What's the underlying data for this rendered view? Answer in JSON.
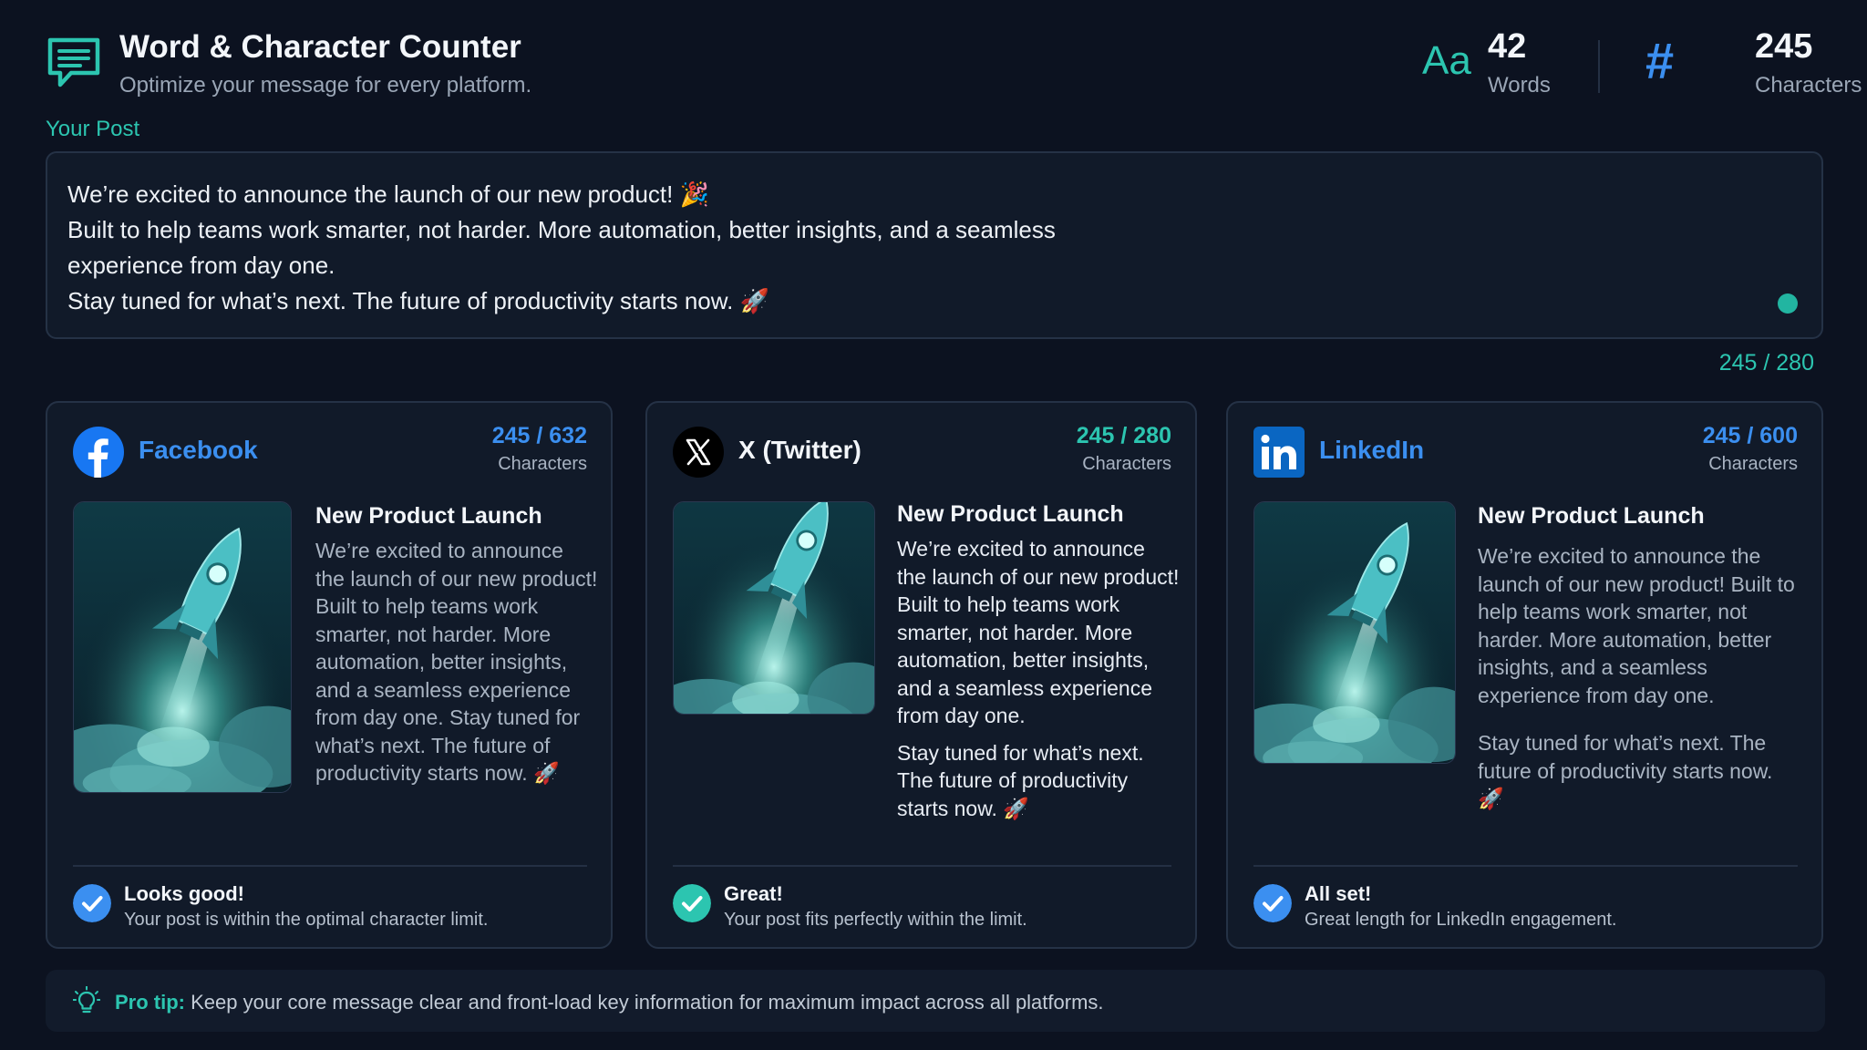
{
  "header": {
    "title": "Word & Character Counter",
    "subtitle": "Optimize your message for every platform.",
    "words": {
      "icon_text": "Aa",
      "value": "42",
      "label": "Words"
    },
    "characters": {
      "icon_text": "#",
      "value": "245",
      "label": "Characters"
    }
  },
  "post": {
    "label": "Your Post",
    "lines": [
      "We’re excited to announce the launch of our new product! 🎉",
      "Built to help teams work smarter, not harder. More automation, better insights, and a seamless",
      "experience from day one.",
      "Stay tuned for what’s next. The future of productivity starts now. 🚀"
    ],
    "count": "245 / 280"
  },
  "cards": [
    {
      "name": "Facebook",
      "count": "245 / 632",
      "count_label": "Characters",
      "headline": "New Product Launch",
      "paragraphs": [
        "We’re excited to announce the launch of our new product! Built to help teams work smarter, not harder. More automation, better insights, and a seamless experience from day one. Stay tuned for what’s next. The future of productivity starts now. 🚀"
      ],
      "status_title": "Looks good!",
      "status_desc": "Your post is within the optimal character limit.",
      "accent": "#3b8ff0"
    },
    {
      "name": "X (Twitter)",
      "count": "245 / 280",
      "count_label": "Characters",
      "headline": "New Product Launch",
      "paragraphs": [
        "We’re excited to announce the launch of our new product! Built to help teams work smarter, not harder. More automation, better insights, and a seamless experience from day one.",
        "Stay tuned for what’s next. The future of productivity starts now. 🚀"
      ],
      "status_title": "Great!",
      "status_desc": "Your post fits perfectly within the limit.",
      "accent": "#2cc5b0"
    },
    {
      "name": "LinkedIn",
      "count": "245 / 600",
      "count_label": "Characters",
      "headline": "New Product Launch",
      "paragraphs": [
        "We’re excited to announce the launch of our new product! Built to help teams work smarter, not harder. More automation, better insights, and a seamless experience from day one.",
        "Stay tuned for what’s next. The future of productivity starts now. 🚀"
      ],
      "status_title": "All set!",
      "status_desc": "Great length for LinkedIn engagement.",
      "accent": "#3b8ff0"
    }
  ],
  "tip": {
    "label": "Pro tip:",
    "text": " Keep your core message clear and front-load key information for maximum impact across all platforms."
  },
  "colors": {
    "background": "#0c1220",
    "teal": "#2cc5b0",
    "blue": "#3b8ff0",
    "facebook": "#1877f2",
    "linkedin": "#0a66c2"
  },
  "icons": [
    "chat-icon",
    "font-icon",
    "hash-icon",
    "facebook-logo-icon",
    "x-logo-icon",
    "linkedin-logo-icon",
    "rocket-image",
    "check-circle-icon",
    "lightbulb-icon"
  ]
}
